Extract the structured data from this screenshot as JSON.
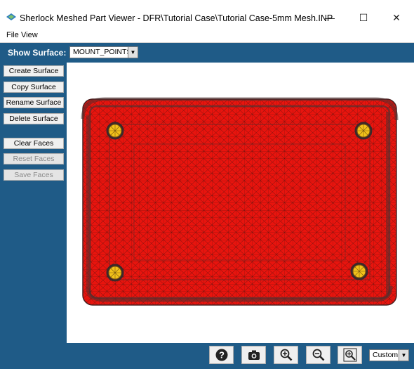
{
  "window": {
    "title": "Sherlock Meshed Part Viewer - DFR\\Tutorial Case\\Tutorial Case-5mm Mesh.INP",
    "minimize_glyph": "—",
    "maximize_glyph": "☐",
    "close_glyph": "✕"
  },
  "menu": {
    "items": [
      "File",
      "View"
    ]
  },
  "surface": {
    "label": "Show Surface:",
    "selected": "MOUNT_POINTS"
  },
  "sidebar": {
    "buttons": [
      {
        "label": "Create Surface",
        "enabled": true
      },
      {
        "label": "Copy Surface",
        "enabled": true
      },
      {
        "label": "Rename Surface",
        "enabled": true
      },
      {
        "label": "Delete Surface",
        "enabled": true
      },
      {
        "label": "Clear Faces",
        "enabled": true
      },
      {
        "label": "Reset Faces",
        "enabled": false
      },
      {
        "label": "Save Faces",
        "enabled": false
      }
    ]
  },
  "toolbar": {
    "icons": [
      "help-icon",
      "camera-icon",
      "zoom-in-icon",
      "zoom-out-icon",
      "zoom-fit-icon"
    ],
    "zoom_select": "Custom"
  },
  "colors": {
    "background": "#1f5b87",
    "mesh_fill": "#e8140e",
    "mesh_lines": "#3a2a2a",
    "mount_points": "#f2c21a"
  }
}
